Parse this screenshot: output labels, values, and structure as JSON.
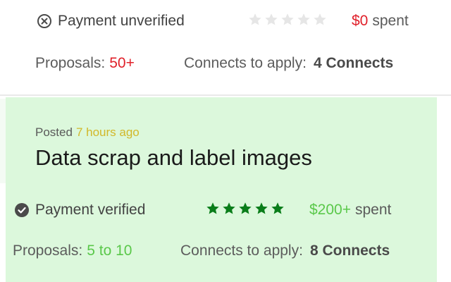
{
  "colors": {
    "card_bg": "#dcf8dc",
    "red": "#e0202a",
    "green_text": "#5ac84a",
    "star_green": "#0a7d1a",
    "star_gray": "#e6e6e6",
    "posted_time": "#d2b82a"
  },
  "previous_job": {
    "payment": {
      "icon": "x-circle-icon",
      "text": "Payment unverified"
    },
    "rating": {
      "stars": 0,
      "max": 5
    },
    "spent": {
      "amount": "$0",
      "label": "spent"
    },
    "proposals": {
      "label": "Proposals:",
      "value": "50+"
    },
    "connects": {
      "label": "Connects to apply:",
      "value": "4 Connects"
    }
  },
  "job": {
    "posted_label": "Posted",
    "posted_time": "7 hours ago",
    "title": "Data scrap and label images",
    "payment": {
      "icon": "check-badge-icon",
      "text": "Payment verified"
    },
    "rating": {
      "stars": 5,
      "max": 5
    },
    "spent": {
      "amount": "$200+",
      "label": "spent"
    },
    "proposals": {
      "label": "Proposals:",
      "value": "5 to 10"
    },
    "connects": {
      "label": "Connects to apply:",
      "value": "8 Connects"
    }
  }
}
